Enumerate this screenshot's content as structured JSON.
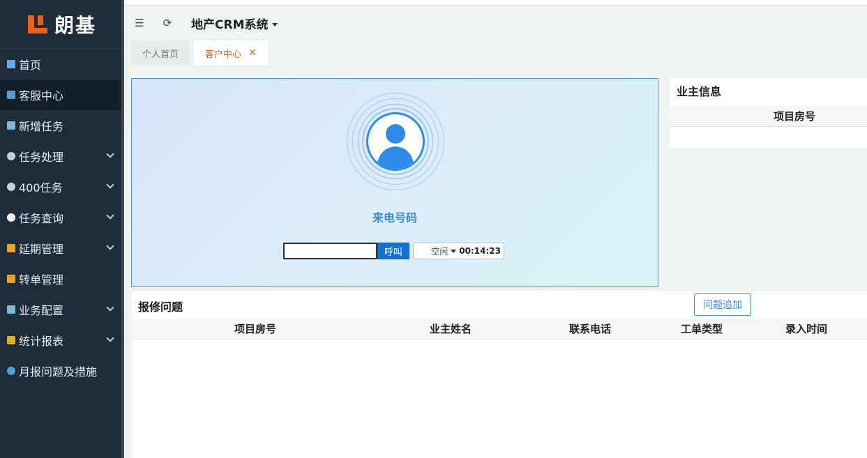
{
  "brand": {
    "name": "朗基"
  },
  "sidebar": {
    "items": [
      {
        "label": "首页",
        "icon": "home-icon",
        "color": "#6aa8e8",
        "expandable": false
      },
      {
        "label": "客服中心",
        "icon": "users-icon",
        "color": "#5b9bd5",
        "expandable": false,
        "active": true
      },
      {
        "label": "新增任务",
        "icon": "add-task-icon",
        "color": "#7fb8d8",
        "expandable": false
      },
      {
        "label": "任务处理",
        "icon": "gear-icon",
        "color": "#c9d0d6",
        "expandable": true
      },
      {
        "label": "400任务",
        "icon": "gear-icon",
        "color": "#c9d0d6",
        "expandable": true
      },
      {
        "label": "任务查询",
        "icon": "search-icon",
        "color": "#ffffff",
        "expandable": true
      },
      {
        "label": "延期管理",
        "icon": "transfer-icon",
        "color": "#f0a030",
        "expandable": true
      },
      {
        "label": "转单管理",
        "icon": "transfer-icon",
        "color": "#f0a030",
        "expandable": false
      },
      {
        "label": "业务配置",
        "icon": "config-icon",
        "color": "#7fb8d8",
        "expandable": true
      },
      {
        "label": "统计报表",
        "icon": "bar-chart-icon",
        "color": "#e8b030",
        "expandable": true
      },
      {
        "label": "月报问题及措施",
        "icon": "info-icon",
        "color": "#4aa8d8",
        "expandable": false
      }
    ]
  },
  "header": {
    "title": "地产CRM系统"
  },
  "tabs": [
    {
      "label": "个人首页",
      "active": false
    },
    {
      "label": "客户中心",
      "active": true,
      "closable": true
    }
  ],
  "call_panel": {
    "label": "来电号码",
    "phone_value": "",
    "call_button": "呼叫",
    "status": "空闲",
    "timer": "00:14:23"
  },
  "owner_info": {
    "title": "业主信息",
    "column": "项目房号"
  },
  "repair": {
    "title": "报修问题",
    "add_button": "问题追加",
    "columns": [
      "项目房号",
      "业主姓名",
      "联系电话",
      "工单类型",
      "录入时间"
    ]
  },
  "colors": {
    "accent": "#e06b1e",
    "primary": "#1770d6",
    "sidebar": "#1f2d3a"
  }
}
